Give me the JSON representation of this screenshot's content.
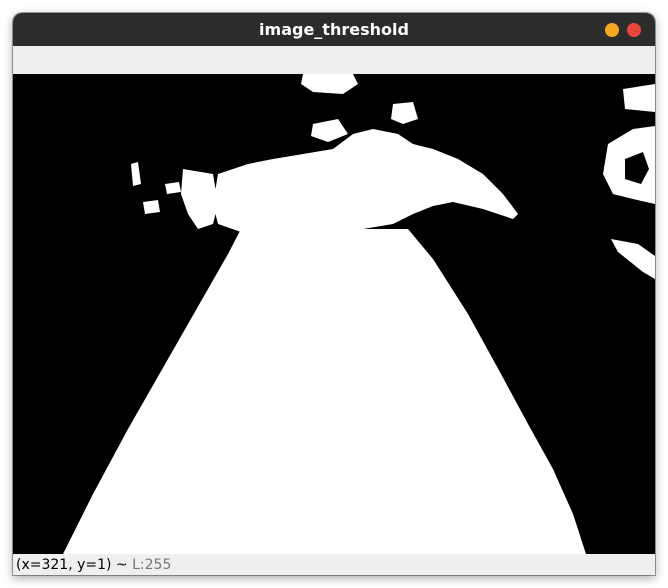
{
  "window": {
    "title": "image_threshold",
    "controls": {
      "minimize_color": "#f5a623",
      "close_color": "#e5473c"
    }
  },
  "image": {
    "type": "binary threshold image",
    "foreground_color": "#ffffff",
    "background_color": "#000000"
  },
  "status": {
    "coords": "(x=321, y=1) ~ ",
    "level": "L:255"
  }
}
